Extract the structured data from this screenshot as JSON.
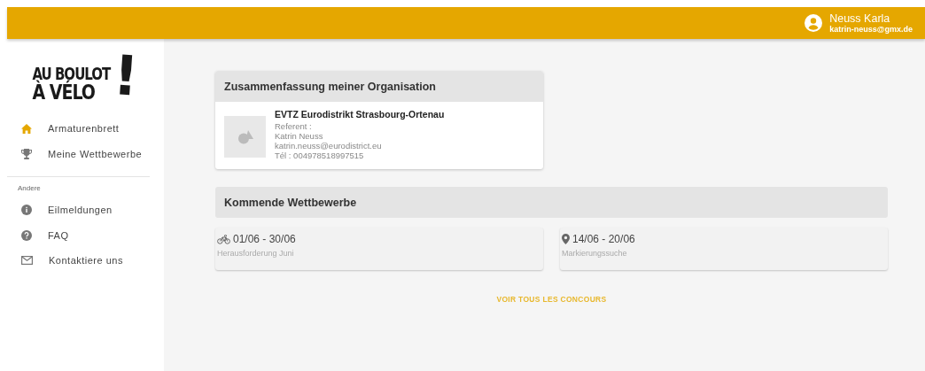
{
  "header": {
    "user_name": "Neuss Karla",
    "user_email": "katrin-neuss@gmx.de"
  },
  "logo": {
    "line_1": "AU BOULOT",
    "line_2": "À VÉLO",
    "mark": "!"
  },
  "sidebar": {
    "items": [
      {
        "label": "Armaturenbrett",
        "kind": "home",
        "selected": true
      },
      {
        "label": "Meine Wettbewerbe",
        "kind": "trophy",
        "selected": false
      }
    ],
    "section_title": "Andere",
    "other_items": [
      {
        "label": "Eilmeldungen",
        "kind": "info",
        "selected": false
      },
      {
        "label": "FAQ",
        "kind": "help",
        "selected": false
      },
      {
        "label": "Kontaktiere uns",
        "kind": "mail",
        "selected": false
      }
    ]
  },
  "organization": {
    "title": "Zusammenfassung meiner Organisation",
    "name": "EVTZ Eurodistrikt Strasbourg-Ortenau",
    "details": [
      "Referent :",
      "Katrin Neuss",
      "katrin.neuss@eurodistrict.eu",
      "Tél : 004978518997515"
    ]
  },
  "competitions": {
    "title": "Kommende Wettbewerbe",
    "items": [
      {
        "kind": "bike",
        "dates": "01/06 - 30/06",
        "name": "Herausforderung Juni"
      },
      {
        "kind": "place",
        "dates": "14/06 - 20/06",
        "name": "Markierungssuche"
      }
    ],
    "link": "VOIR TOUS LES CONCOURS"
  }
}
